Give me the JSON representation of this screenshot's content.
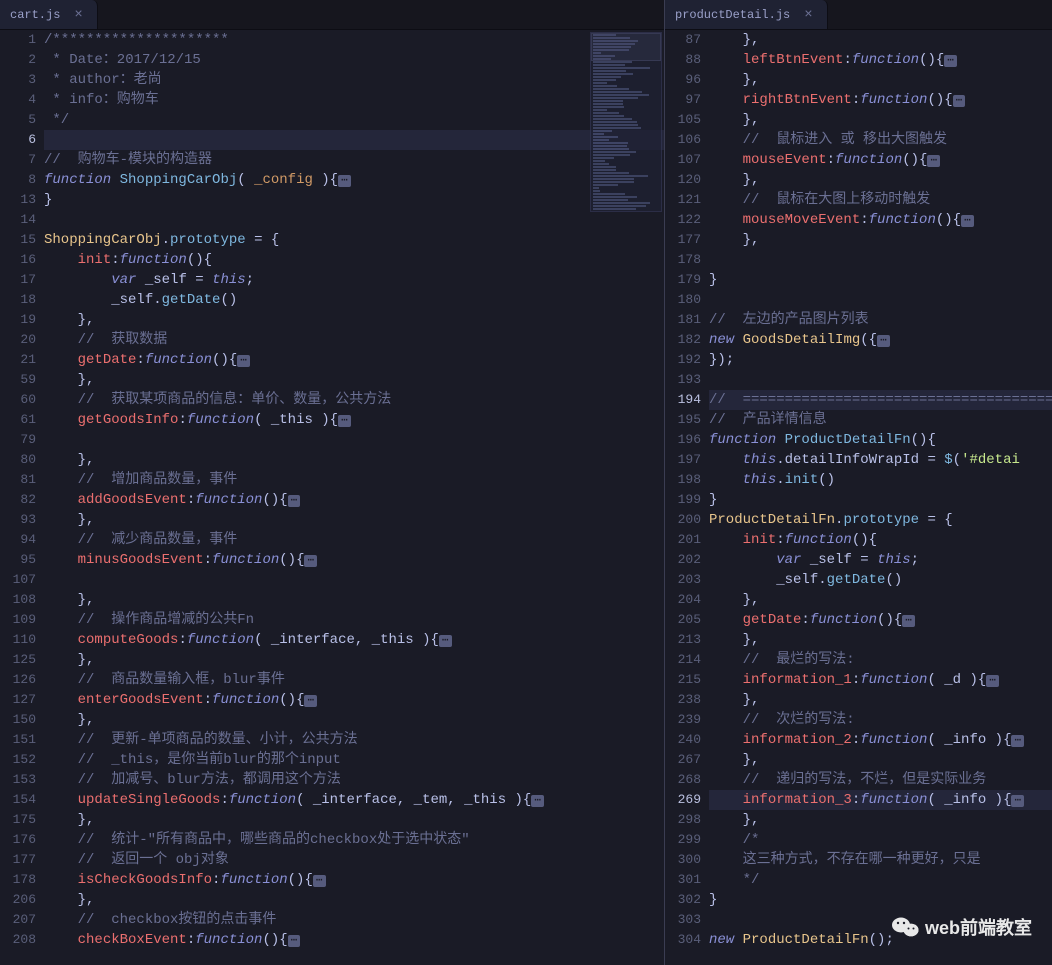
{
  "tabs": {
    "left": {
      "title": "cart.js",
      "close": "×"
    },
    "right": {
      "title": "productDetail.js",
      "close": "×"
    }
  },
  "watermark": {
    "text": "web前端教室"
  },
  "left": {
    "lines": [
      {
        "n": 1,
        "t": "comment",
        "text": "/*********************"
      },
      {
        "n": 2,
        "t": "comment",
        "text": " * Date：2017/12/15"
      },
      {
        "n": 3,
        "t": "comment",
        "text": " * author：老尚"
      },
      {
        "n": 4,
        "t": "comment",
        "text": " * info：购物车"
      },
      {
        "n": 5,
        "t": "comment",
        "text": " */"
      },
      {
        "n": 6,
        "t": "blank-hl",
        "text": ""
      },
      {
        "n": 7,
        "t": "comment",
        "text": "//  购物车-模块的构造器"
      },
      {
        "n": 8,
        "t": "fn-decl-fold",
        "kw": "function",
        "name": "ShoppingCarObj",
        "params": "_config"
      },
      {
        "n": 13,
        "t": "close",
        "text": "}"
      },
      {
        "n": 14,
        "t": "blank",
        "text": ""
      },
      {
        "n": 15,
        "t": "proto",
        "cls": "ShoppingCarObj",
        "text": ".prototype = {"
      },
      {
        "n": 16,
        "t": "prop-fn",
        "prop": "init",
        "params": ""
      },
      {
        "n": 17,
        "t": "var-self",
        "text": "var _self = this;"
      },
      {
        "n": 18,
        "t": "self-call",
        "method": "getDate",
        "text": "_self.getDate()"
      },
      {
        "n": 19,
        "t": "close-prop",
        "text": "},"
      },
      {
        "n": 20,
        "t": "comment-in",
        "text": "//  获取数据"
      },
      {
        "n": 21,
        "t": "prop-fn-fold",
        "prop": "getDate",
        "params": ""
      },
      {
        "n": 59,
        "t": "close-prop",
        "text": "},"
      },
      {
        "n": 60,
        "t": "comment-in",
        "text": "//  获取某项商品的信息：单价、数量，公共方法"
      },
      {
        "n": 61,
        "t": "prop-fn-fold",
        "prop": "getGoodsInfo",
        "params": "_this"
      },
      {
        "n": 79,
        "t": "blank",
        "text": ""
      },
      {
        "n": 80,
        "t": "close-prop",
        "text": "},"
      },
      {
        "n": 81,
        "t": "comment-in",
        "text": "//  增加商品数量，事件"
      },
      {
        "n": 82,
        "t": "prop-fn-fold",
        "prop": "addGoodsEvent",
        "params": ""
      },
      {
        "n": 93,
        "t": "close-prop",
        "text": "},"
      },
      {
        "n": 94,
        "t": "comment-in",
        "text": "//  减少商品数量，事件"
      },
      {
        "n": 95,
        "t": "prop-fn-fold",
        "prop": "minusGoodsEvent",
        "params": ""
      },
      {
        "n": 107,
        "t": "blank",
        "text": ""
      },
      {
        "n": 108,
        "t": "close-prop",
        "text": "},"
      },
      {
        "n": 109,
        "t": "comment-in",
        "text": "//  操作商品增减的公共Fn"
      },
      {
        "n": 110,
        "t": "prop-fn-fold",
        "prop": "computeGoods",
        "params": "_interface, _this"
      },
      {
        "n": 125,
        "t": "close-prop",
        "text": "},"
      },
      {
        "n": 126,
        "t": "comment-in",
        "text": "//  商品数量输入框，blur事件"
      },
      {
        "n": 127,
        "t": "prop-fn-fold",
        "prop": "enterGoodsEvent",
        "params": ""
      },
      {
        "n": 150,
        "t": "close-prop",
        "text": "},"
      },
      {
        "n": 151,
        "t": "comment-in",
        "text": "//  更新-单项商品的数量、小计，公共方法"
      },
      {
        "n": 152,
        "t": "comment-in",
        "text": "//  _this，是你当前blur的那个input"
      },
      {
        "n": 153,
        "t": "comment-in",
        "text": "//  加减号、blur方法，都调用这个方法"
      },
      {
        "n": 154,
        "t": "prop-fn-fold",
        "prop": "updateSingleGoods",
        "params": "_interface, _tem, _this"
      },
      {
        "n": 175,
        "t": "close-prop",
        "text": "},"
      },
      {
        "n": 176,
        "t": "comment-in",
        "text": "//  统计-\"所有商品中，哪些商品的checkbox处于选中状态\""
      },
      {
        "n": 177,
        "t": "comment-in",
        "text": "//  返回一个 obj对象"
      },
      {
        "n": 178,
        "t": "prop-fn-fold",
        "prop": "isCheckGoodsInfo",
        "params": ""
      },
      {
        "n": 206,
        "t": "close-prop",
        "text": "},"
      },
      {
        "n": 207,
        "t": "comment-in",
        "text": "//  checkbox按钮的点击事件"
      },
      {
        "n": 208,
        "t": "prop-fn-fold",
        "prop": "checkBoxEvent",
        "params": ""
      }
    ]
  },
  "right": {
    "lines": [
      {
        "n": 87,
        "t": "close-prop",
        "text": "},"
      },
      {
        "n": 88,
        "t": "prop-fn-fold",
        "prop": "leftBtnEvent",
        "params": ""
      },
      {
        "n": 96,
        "t": "close-prop",
        "text": "},"
      },
      {
        "n": 97,
        "t": "prop-fn-fold",
        "prop": "rightBtnEvent",
        "params": ""
      },
      {
        "n": 105,
        "t": "close-prop",
        "text": "},"
      },
      {
        "n": 106,
        "t": "comment-in",
        "text": "//  鼠标进入 或 移出大图触发"
      },
      {
        "n": 107,
        "t": "prop-fn-fold",
        "prop": "mouseEvent",
        "params": ""
      },
      {
        "n": 120,
        "t": "close-prop",
        "text": "},"
      },
      {
        "n": 121,
        "t": "comment-in",
        "text": "//  鼠标在大图上移动时触发"
      },
      {
        "n": 122,
        "t": "prop-fn-fold",
        "prop": "mouseMoveEvent",
        "params": ""
      },
      {
        "n": 177,
        "t": "close-prop",
        "text": "},"
      },
      {
        "n": 178,
        "t": "blank",
        "text": ""
      },
      {
        "n": 179,
        "t": "close",
        "text": "}"
      },
      {
        "n": 180,
        "t": "blank",
        "text": ""
      },
      {
        "n": 181,
        "t": "comment",
        "text": "//  左边的产品图片列表"
      },
      {
        "n": 182,
        "t": "new-fold",
        "cls": "GoodsDetailImg",
        "text": "new GoodsDetailImg({"
      },
      {
        "n": 192,
        "t": "close-call",
        "text": "});"
      },
      {
        "n": 193,
        "t": "blank",
        "text": ""
      },
      {
        "n": 194,
        "t": "comment-hl",
        "text": "//  ======================================"
      },
      {
        "n": 195,
        "t": "comment",
        "text": "//  产品详情信息"
      },
      {
        "n": 196,
        "t": "fn-decl",
        "kw": "function",
        "name": "ProductDetailFn",
        "params": ""
      },
      {
        "n": 197,
        "t": "assign",
        "text": "    this.detailInfoWrapId = $('#detai"
      },
      {
        "n": 198,
        "t": "this-call",
        "text": "    this.init()"
      },
      {
        "n": 199,
        "t": "close",
        "text": "}"
      },
      {
        "n": 200,
        "t": "proto",
        "cls": "ProductDetailFn",
        "text": ".prototype = {"
      },
      {
        "n": 201,
        "t": "prop-fn",
        "prop": "init",
        "params": ""
      },
      {
        "n": 202,
        "t": "var-self",
        "text": "var _self = this;"
      },
      {
        "n": 203,
        "t": "self-call",
        "method": "getDate",
        "text": "_self.getDate()"
      },
      {
        "n": 204,
        "t": "close-prop",
        "text": "},"
      },
      {
        "n": 205,
        "t": "prop-fn-fold",
        "prop": "getDate",
        "params": ""
      },
      {
        "n": 213,
        "t": "close-prop",
        "text": "},"
      },
      {
        "n": 214,
        "t": "comment-in",
        "text": "//  最烂的写法:"
      },
      {
        "n": 215,
        "t": "prop-fn-fold",
        "prop": "information_1",
        "params": "_d"
      },
      {
        "n": 238,
        "t": "close-prop",
        "text": "},"
      },
      {
        "n": 239,
        "t": "comment-in",
        "text": "//  次烂的写法:"
      },
      {
        "n": 240,
        "t": "prop-fn-fold",
        "prop": "information_2",
        "params": "_info"
      },
      {
        "n": 267,
        "t": "close-prop",
        "text": "},"
      },
      {
        "n": 268,
        "t": "comment-in",
        "text": "//  递归的写法，不烂，但是实际业务"
      },
      {
        "n": 269,
        "t": "prop-fn-fold-hl",
        "prop": "information_3",
        "params": "_info"
      },
      {
        "n": 298,
        "t": "close-prop",
        "text": "},"
      },
      {
        "n": 299,
        "t": "comment-in",
        "text": "/*"
      },
      {
        "n": 300,
        "t": "comment-in",
        "text": "这三种方式，不存在哪一种更好，只是"
      },
      {
        "n": 301,
        "t": "comment-in",
        "text": "*/"
      },
      {
        "n": 302,
        "t": "close",
        "text": "}"
      },
      {
        "n": 303,
        "t": "blank",
        "text": ""
      },
      {
        "n": 304,
        "t": "new-call",
        "cls": "ProductDetailFn",
        "text": "new ProductDetailFn();"
      }
    ]
  }
}
